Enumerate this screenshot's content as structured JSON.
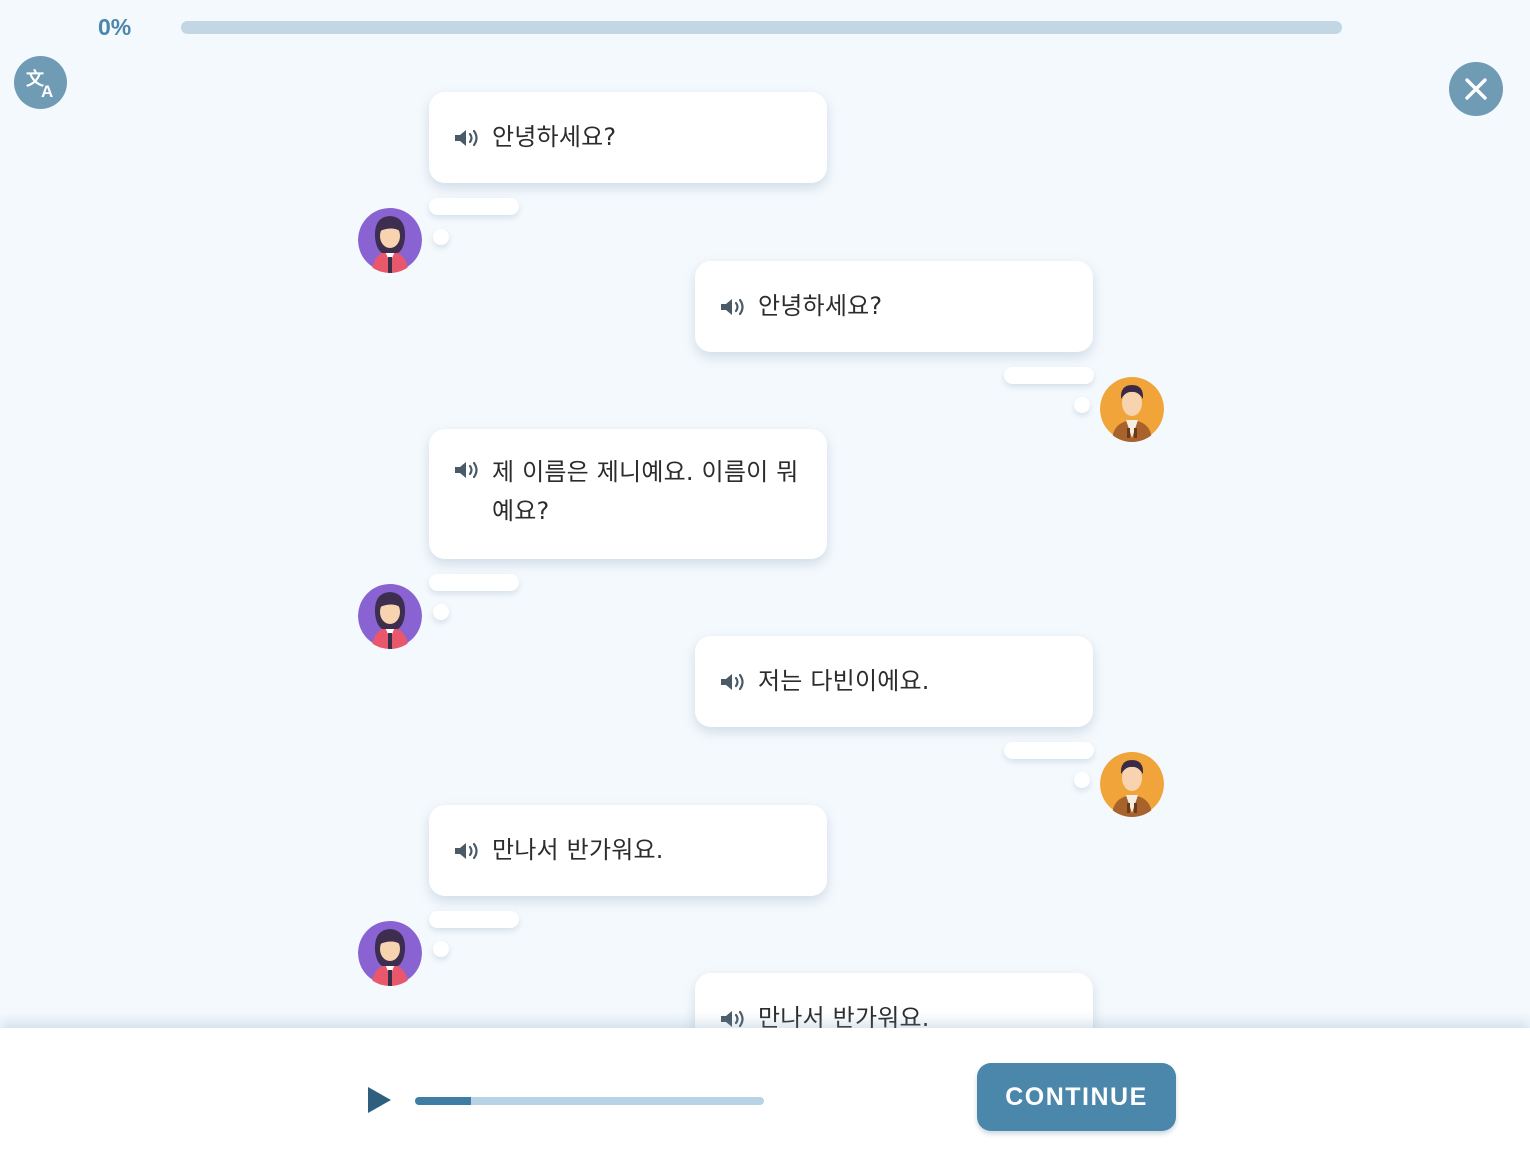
{
  "progress": {
    "label": "0%",
    "fraction": 0.0
  },
  "icons": {
    "translate": "translate-icon",
    "close": "close-icon",
    "speaker": "speaker-icon",
    "play": "play-icon"
  },
  "avatars": {
    "female": "female-avatar",
    "male": "male-avatar"
  },
  "messages": [
    {
      "speaker": "female",
      "text": "안녕하세요?"
    },
    {
      "speaker": "male",
      "text": "안녕하세요?"
    },
    {
      "speaker": "female",
      "text": "제 이름은 제니예요. 이름이 뭐예요?"
    },
    {
      "speaker": "male",
      "text": "저는 다빈이에요."
    },
    {
      "speaker": "female",
      "text": "만나서 반가워요."
    },
    {
      "speaker": "male",
      "text": "만나서 반가워요."
    }
  ],
  "player": {
    "progress_fraction": 0.16
  },
  "continue_label": "CONTINUE",
  "colors": {
    "accent": "#4a87ab",
    "track": "#c3d6e3",
    "background": "#f4f9fd",
    "icon_button": "#6f9bb5"
  }
}
